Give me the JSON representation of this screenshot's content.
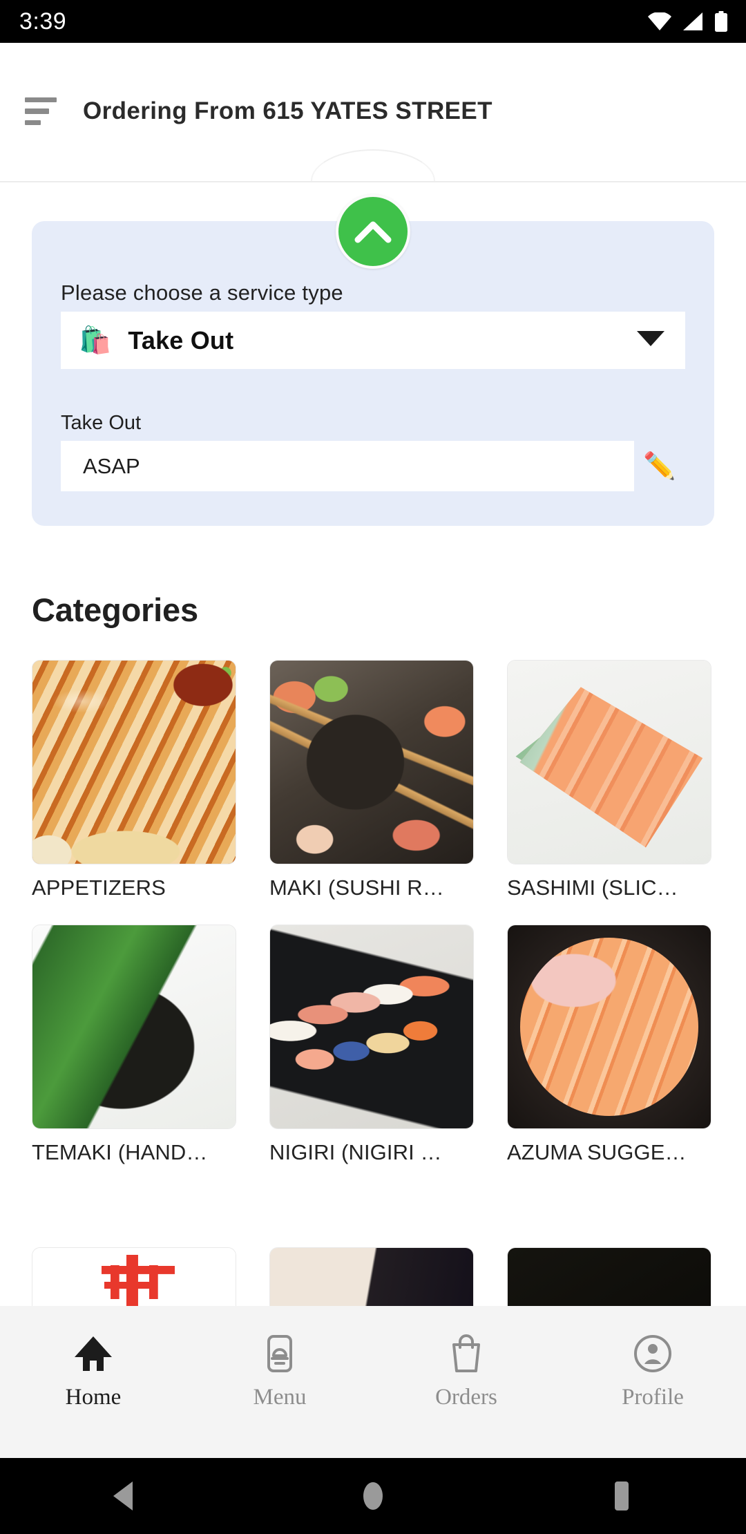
{
  "status_bar": {
    "time": "3:39",
    "icons": [
      "wifi-icon",
      "cell-signal-icon",
      "battery-icon"
    ]
  },
  "header": {
    "menu_icon": "sort-hamburger-icon",
    "title": "Ordering From 615 YATES STREET"
  },
  "collapse_button": {
    "icon": "chevron-up-icon",
    "color": "#3fc14a"
  },
  "service_card": {
    "background": "#e6ecf9",
    "prompt_label": "Please choose a service type",
    "service_type": {
      "emoji": "🛍️",
      "value": "Take Out",
      "caret_icon": "caret-down-icon"
    },
    "time_section": {
      "label": "Take Out",
      "value": "ASAP",
      "edit_icon": "✏️"
    }
  },
  "categories": {
    "title": "Categories",
    "items": [
      {
        "name": "APPETIZERS",
        "art": "art-appetizer"
      },
      {
        "name": "MAKI (SUSHI R…",
        "art": "art-maki"
      },
      {
        "name": "SASHIMI (SLIC…",
        "art": "art-sashimi"
      },
      {
        "name": "TEMAKI (HAND…",
        "art": "art-temaki"
      },
      {
        "name": "NIGIRI (NIGIRI …",
        "art": "art-nigiri"
      },
      {
        "name": "AZUMA SUGGE…",
        "art": "art-azuma"
      }
    ],
    "partial_row": [
      {
        "art": "art-partial-red"
      },
      {
        "art": "art-partial-plate"
      },
      {
        "art": "art-partial-dark"
      }
    ]
  },
  "bottom_nav": {
    "active": "Home",
    "items": [
      {
        "label": "Home",
        "icon": "home-icon"
      },
      {
        "label": "Menu",
        "icon": "menu-dish-icon"
      },
      {
        "label": "Orders",
        "icon": "shopping-bag-icon"
      },
      {
        "label": "Profile",
        "icon": "user-circle-icon"
      }
    ]
  },
  "system_nav": {
    "items": [
      {
        "icon": "back-triangle-icon"
      },
      {
        "icon": "home-circle-icon"
      },
      {
        "icon": "recents-square-icon"
      }
    ]
  }
}
